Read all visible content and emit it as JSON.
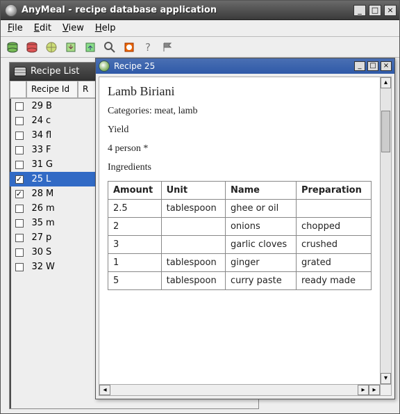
{
  "window": {
    "title": "AnyMeal - recipe database application"
  },
  "menu": {
    "file": "File",
    "edit": "Edit",
    "view": "View",
    "help": "Help"
  },
  "left": {
    "title": "Recipe List",
    "headers": {
      "id": "Recipe Id",
      "name": "R"
    },
    "rows": [
      {
        "checked": false,
        "id": "29",
        "name": "B"
      },
      {
        "checked": false,
        "id": "24",
        "name": "c"
      },
      {
        "checked": false,
        "id": "34",
        "name": "fl"
      },
      {
        "checked": false,
        "id": "33",
        "name": "F"
      },
      {
        "checked": false,
        "id": "31",
        "name": "G"
      },
      {
        "checked": true,
        "id": "25",
        "name": "L",
        "selected": true
      },
      {
        "checked": true,
        "id": "28",
        "name": "M"
      },
      {
        "checked": false,
        "id": "26",
        "name": "m"
      },
      {
        "checked": false,
        "id": "35",
        "name": "m"
      },
      {
        "checked": false,
        "id": "27",
        "name": "p"
      },
      {
        "checked": false,
        "id": "30",
        "name": "S"
      },
      {
        "checked": false,
        "id": "32",
        "name": "W"
      }
    ]
  },
  "inner": {
    "title": "Recipe 25"
  },
  "doc": {
    "title": "Lamb Biriani",
    "categories": "Categories: meat, lamb",
    "yield_label": "Yield",
    "yield_value": "4 person *",
    "ingredients_label": "Ingredients",
    "headers": {
      "amount": "Amount",
      "unit": "Unit",
      "name": "Name",
      "prep": "Preparation"
    },
    "ingredients": [
      {
        "amount": "2.5",
        "unit": "tablespoon",
        "name": "ghee or oil",
        "prep": ""
      },
      {
        "amount": "2",
        "unit": "",
        "name": "onions",
        "prep": "chopped"
      },
      {
        "amount": "3",
        "unit": "",
        "name": "garlic cloves",
        "prep": "crushed"
      },
      {
        "amount": "1",
        "unit": "tablespoon",
        "name": "ginger",
        "prep": "grated"
      },
      {
        "amount": "5",
        "unit": "tablespoon",
        "name": "curry paste",
        "prep": "ready made"
      }
    ]
  }
}
